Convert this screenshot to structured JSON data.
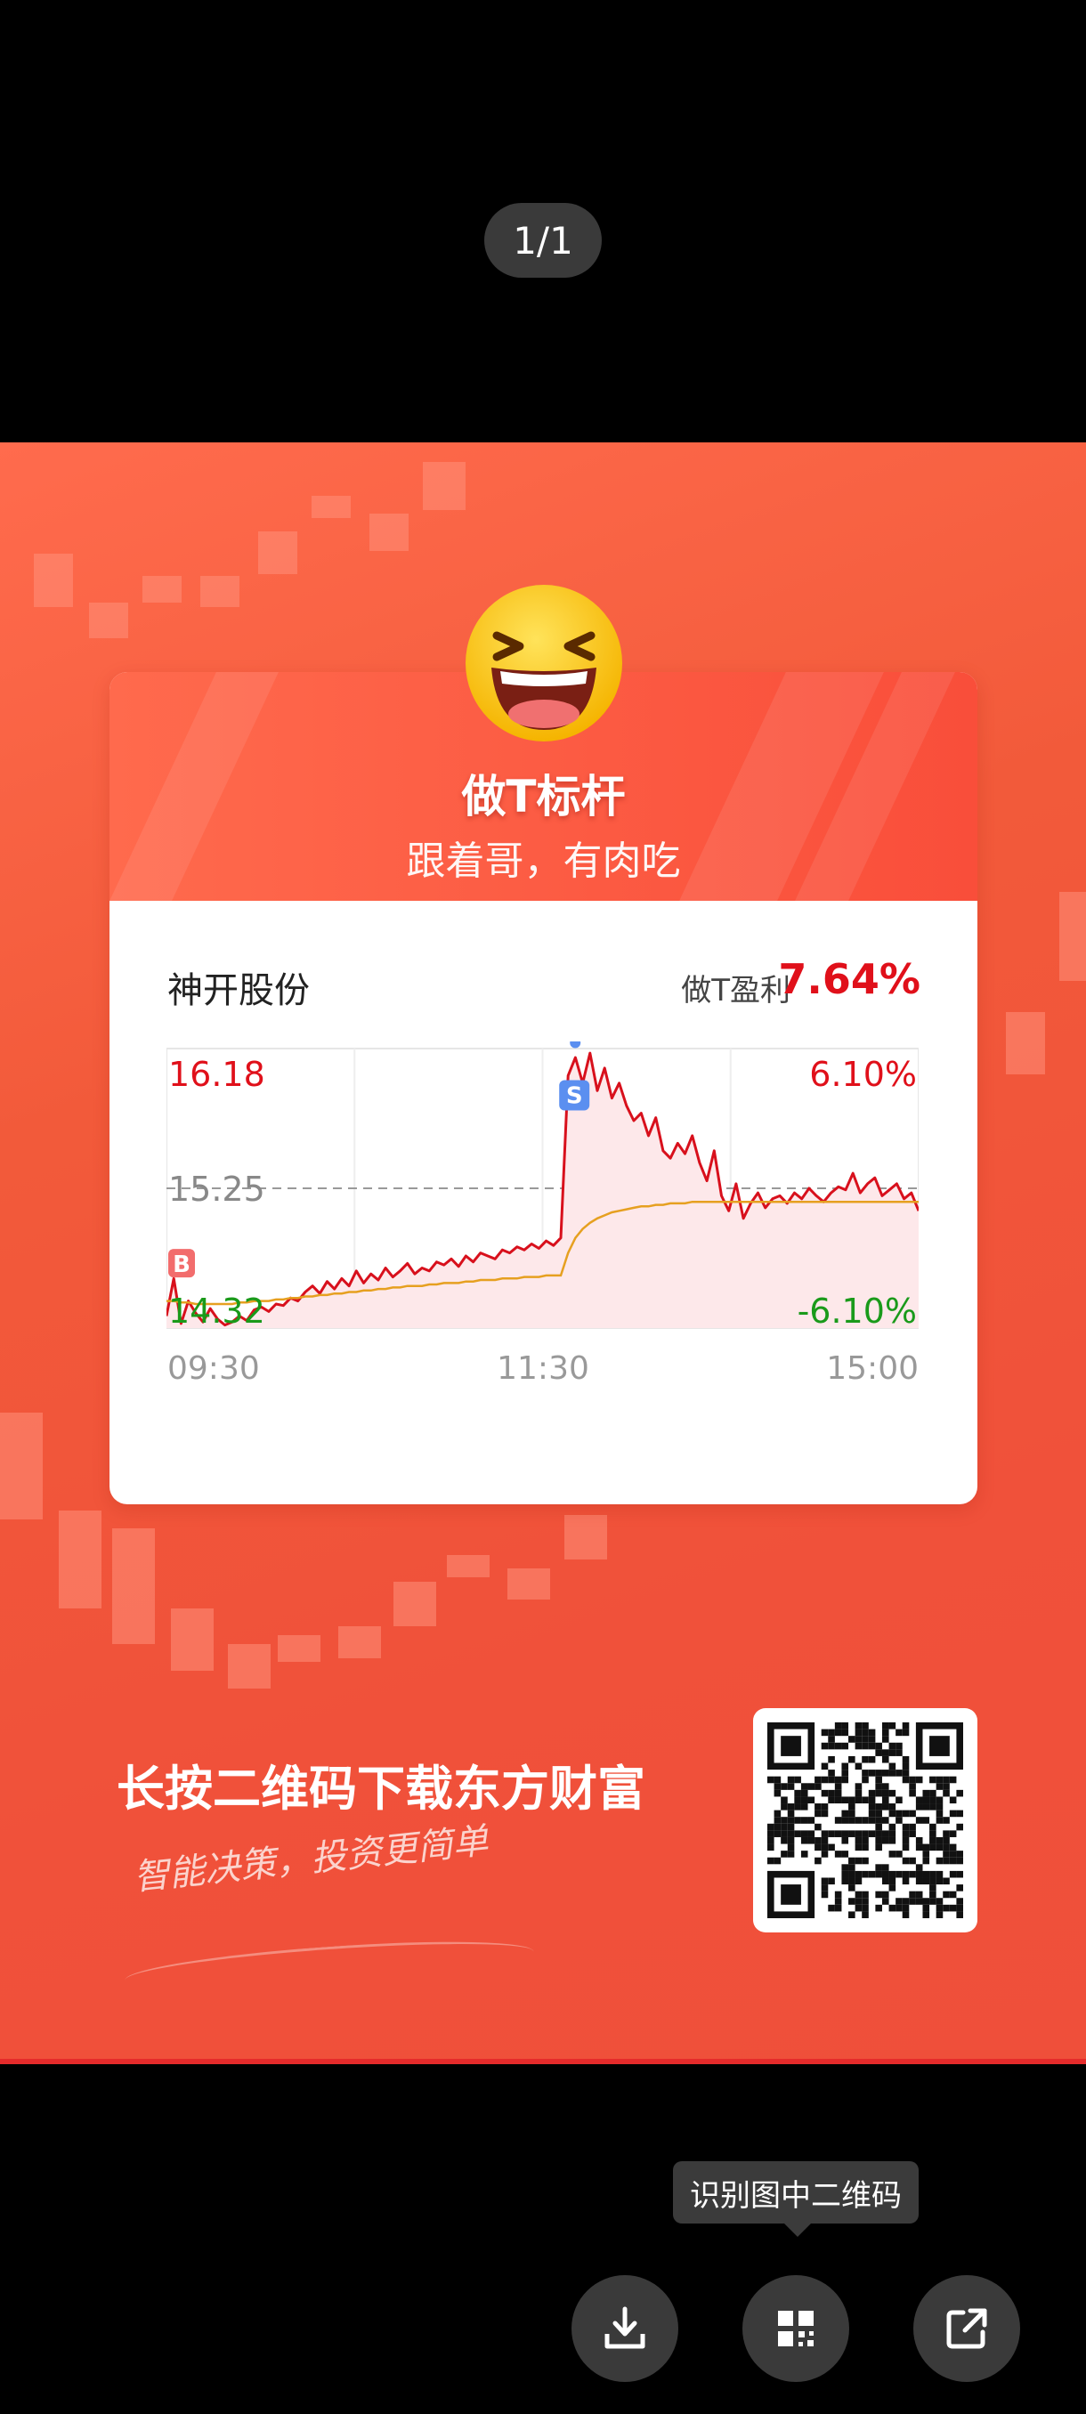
{
  "viewer": {
    "page_counter": "1/1",
    "tooltip": "识别图中二维码",
    "actions": [
      {
        "name": "download-icon"
      },
      {
        "name": "qr-scan-icon"
      },
      {
        "name": "share-icon"
      }
    ]
  },
  "poster": {
    "title": "做T标杆",
    "subtitle": "跟着哥，有肉吃",
    "stock_name": "神开股份",
    "profit_label": "做T盈利",
    "profit_value": "7.64%",
    "cta": "长按二维码下载东方财富",
    "slogan": "智能决策，投资更简单",
    "colors": {
      "accent_red": "#e0101a",
      "down_green": "#1a9a1a",
      "poster_bg": "#f25a3a"
    }
  },
  "chart_data": {
    "type": "line",
    "price_high_label": "16.18",
    "price_mid_label": "15.25",
    "price_low_label": "14.32",
    "pct_high_label": "6.10%",
    "pct_low_label": "-6.10%",
    "x_tick_labels": [
      "09:30",
      "11:30",
      "15:00"
    ],
    "ylim": [
      14.32,
      16.18
    ],
    "reference_price": 15.25,
    "markers": [
      {
        "label": "B",
        "time_index": 0,
        "price": 14.55
      },
      {
        "label": "S",
        "time_index": 55,
        "price": 16.1
      }
    ],
    "series": [
      {
        "name": "price",
        "color": "#d8101c",
        "values": [
          14.4,
          14.65,
          14.35,
          14.5,
          14.42,
          14.36,
          14.45,
          14.38,
          14.34,
          14.36,
          14.4,
          14.37,
          14.44,
          14.46,
          14.43,
          14.48,
          14.47,
          14.52,
          14.5,
          14.56,
          14.6,
          14.55,
          14.63,
          14.58,
          14.65,
          14.6,
          14.7,
          14.62,
          14.68,
          14.64,
          14.72,
          14.66,
          14.7,
          14.75,
          14.68,
          14.72,
          14.7,
          14.76,
          14.74,
          14.78,
          14.73,
          14.8,
          14.76,
          14.82,
          14.8,
          14.78,
          14.84,
          14.82,
          14.86,
          14.84,
          14.88,
          14.85,
          14.9,
          14.87,
          14.92,
          16.0,
          16.12,
          15.95,
          16.15,
          15.9,
          16.05,
          15.85,
          15.95,
          15.8,
          15.7,
          15.75,
          15.6,
          15.72,
          15.5,
          15.45,
          15.55,
          15.48,
          15.6,
          15.42,
          15.3,
          15.5,
          15.2,
          15.1,
          15.28,
          15.05,
          15.15,
          15.22,
          15.12,
          15.18,
          15.2,
          15.15,
          15.22,
          15.18,
          15.25,
          15.2,
          15.16,
          15.22,
          15.26,
          15.24,
          15.35,
          15.22,
          15.28,
          15.32,
          15.2,
          15.24,
          15.28,
          15.18,
          15.22,
          15.1
        ]
      },
      {
        "name": "average",
        "color": "#e6a020",
        "values": [
          14.5,
          14.5,
          14.49,
          14.49,
          14.48,
          14.48,
          14.48,
          14.48,
          14.48,
          14.48,
          14.49,
          14.49,
          14.5,
          14.5,
          14.5,
          14.51,
          14.51,
          14.52,
          14.52,
          14.53,
          14.53,
          14.54,
          14.54,
          14.55,
          14.55,
          14.56,
          14.56,
          14.57,
          14.57,
          14.58,
          14.58,
          14.59,
          14.59,
          14.6,
          14.6,
          14.6,
          14.61,
          14.61,
          14.62,
          14.62,
          14.62,
          14.63,
          14.63,
          14.64,
          14.64,
          14.64,
          14.65,
          14.65,
          14.65,
          14.66,
          14.66,
          14.66,
          14.67,
          14.67,
          14.67,
          14.82,
          14.92,
          14.98,
          15.02,
          15.05,
          15.07,
          15.09,
          15.1,
          15.11,
          15.12,
          15.13,
          15.13,
          15.14,
          15.14,
          15.15,
          15.15,
          15.15,
          15.16,
          15.16,
          15.16,
          15.16,
          15.16,
          15.16,
          15.16,
          15.16,
          15.16,
          15.16,
          15.16,
          15.16,
          15.16,
          15.16,
          15.16,
          15.16,
          15.16,
          15.16,
          15.16,
          15.16,
          15.16,
          15.16,
          15.16,
          15.16,
          15.16,
          15.16,
          15.16,
          15.16,
          15.16,
          15.16,
          15.16,
          15.16
        ]
      }
    ]
  }
}
